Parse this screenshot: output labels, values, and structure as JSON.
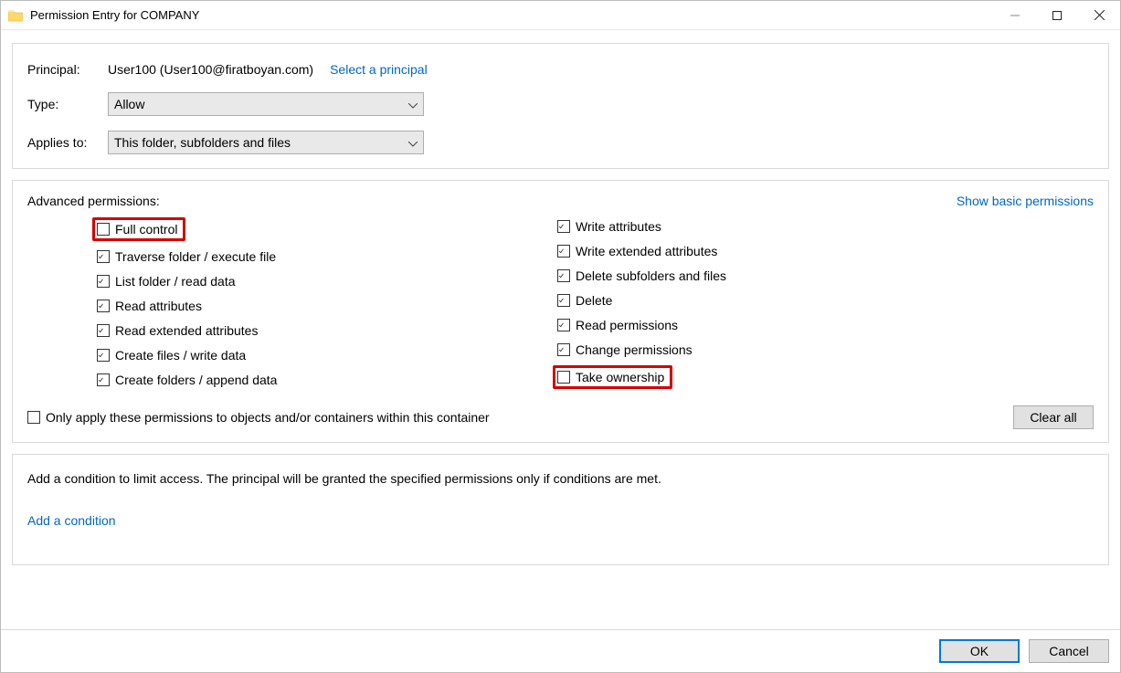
{
  "window": {
    "title": "Permission Entry for COMPANY"
  },
  "principal": {
    "label": "Principal:",
    "value": "User100 (User100@firatboyan.com)",
    "select_link": "Select a principal"
  },
  "type": {
    "label": "Type:",
    "value": "Allow"
  },
  "applies": {
    "label": "Applies to:",
    "value": "This folder, subfolders and files"
  },
  "permissions": {
    "heading": "Advanced permissions:",
    "basic_link": "Show basic permissions",
    "left": [
      {
        "label": "Full control",
        "checked": false,
        "highlight": true
      },
      {
        "label": "Traverse folder / execute file",
        "checked": true
      },
      {
        "label": "List folder / read data",
        "checked": true
      },
      {
        "label": "Read attributes",
        "checked": true
      },
      {
        "label": "Read extended attributes",
        "checked": true
      },
      {
        "label": "Create files / write data",
        "checked": true
      },
      {
        "label": "Create folders / append data",
        "checked": true
      }
    ],
    "right": [
      {
        "label": "Write attributes",
        "checked": true
      },
      {
        "label": "Write extended attributes",
        "checked": true
      },
      {
        "label": "Delete subfolders and files",
        "checked": true
      },
      {
        "label": "Delete",
        "checked": true
      },
      {
        "label": "Read permissions",
        "checked": true
      },
      {
        "label": "Change permissions",
        "checked": true
      },
      {
        "label": "Take ownership",
        "checked": false,
        "highlight": true
      }
    ],
    "only_apply": "Only apply these permissions to objects and/or containers within this container",
    "clear_all": "Clear all"
  },
  "condition": {
    "text": "Add a condition to limit access. The principal will be granted the specified permissions only if conditions are met.",
    "link": "Add a condition"
  },
  "buttons": {
    "ok": "OK",
    "cancel": "Cancel"
  }
}
